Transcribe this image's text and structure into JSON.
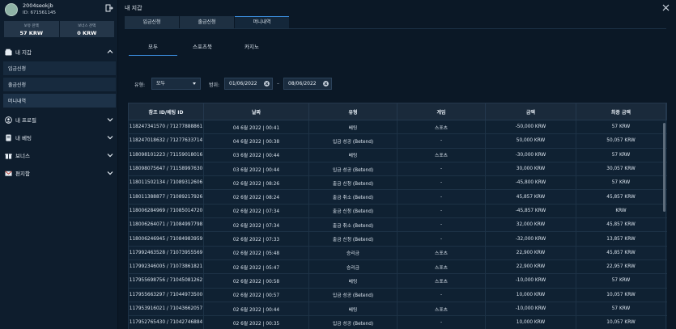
{
  "profile": {
    "username": "2004seokjb",
    "user_id": "ID: 671561145"
  },
  "balance": {
    "betting_label": "보유 잔액",
    "betting_value": "57 KRW",
    "bonus_label": "보너스 잔액",
    "bonus_value": "0 KRW"
  },
  "menu": {
    "wallet": "내 지갑",
    "wallet_items": [
      "입금신청",
      "출금신청",
      "머니내역"
    ],
    "profile": "내 프로필",
    "bets": "내 베팅",
    "bonus": "보너스",
    "mailbox": "편지함"
  },
  "main": {
    "title": "내 지갑",
    "tabs": [
      "입금신청",
      "출금신청",
      "머니내역"
    ],
    "subtabs": [
      "모두",
      "스포츠북",
      "카지노"
    ]
  },
  "filters": {
    "type_label": "유형:",
    "type_value": "모두",
    "range_label": "범위:",
    "date_from": "01/06/2022",
    "date_to": "08/06/2022",
    "dash": "–"
  },
  "table": {
    "headers": [
      "참조 ID/베팅 ID",
      "날짜",
      "유형",
      "게임",
      "금액",
      "최종 금액"
    ],
    "rows": [
      [
        "118247341570 / 71277888861",
        "04 6월 2022 | 00:41",
        "베팅",
        "스포츠",
        "-50,000 KRW",
        "57 KRW"
      ],
      [
        "118247018632 / 71277633714",
        "04 6월 2022 | 00:38",
        "입금 성공 (Betend)",
        "-",
        "50,000 KRW",
        "50,057 KRW"
      ],
      [
        "118098101223 / 71159018016",
        "03 6월 2022 | 00:44",
        "베팅",
        "스포츠",
        "-30,000 KRW",
        "57 KRW"
      ],
      [
        "118098075647 / 71158997630",
        "03 6월 2022 | 00:44",
        "입금 성공 (Betend)",
        "-",
        "30,000 KRW",
        "30,057 KRW"
      ],
      [
        "118011502134 / 71089312606",
        "02 6월 2022 | 08:26",
        "출금 신청 (Betend)",
        "-",
        "-45,800 KRW",
        "57 KRW"
      ],
      [
        "118011388877 / 71089217926",
        "02 6월 2022 | 08:24",
        "출금 취소 (Betend)",
        "-",
        "45,857 KRW",
        "45,857 KRW"
      ],
      [
        "118006284969 / 71085014720",
        "02 6월 2022 | 07:34",
        "출금 신청 (Betend)",
        "-",
        "-45,857 KRW",
        "KRW"
      ],
      [
        "118006264071 / 71084997798",
        "02 6월 2022 | 07:34",
        "출금 취소 (Betend)",
        "-",
        "32,000 KRW",
        "45,857 KRW"
      ],
      [
        "118006246945 / 71084983959",
        "02 6월 2022 | 07:33",
        "출금 신청 (Betend)",
        "-",
        "-32,000 KRW",
        "13,857 KRW"
      ],
      [
        "117992463528 / 71073955569",
        "02 6월 2022 | 05:48",
        "승리금",
        "스포츠",
        "22,900 KRW",
        "45,857 KRW"
      ],
      [
        "117992346005 / 71073861821",
        "02 6월 2022 | 05:47",
        "승리금",
        "스포츠",
        "22,900 KRW",
        "22,957 KRW"
      ],
      [
        "117955698756 / 71045081262",
        "02 6월 2022 | 00:58",
        "베팅",
        "스포츠",
        "-10,000 KRW",
        "57 KRW"
      ],
      [
        "117955663297 / 71044973500",
        "02 6월 2022 | 00:57",
        "입금 성공 (Betend)",
        "-",
        "10,000 KRW",
        "10,057 KRW"
      ],
      [
        "117953916021 / 71043662057",
        "02 6월 2022 | 00:44",
        "베팅",
        "스포츠",
        "-10,000 KRW",
        "57 KRW"
      ],
      [
        "117952765430 / 71042746884",
        "02 6월 2022 | 00:35",
        "입금 성공 (Betend)",
        "-",
        "10,000 KRW",
        "10,057 KRW"
      ]
    ]
  }
}
